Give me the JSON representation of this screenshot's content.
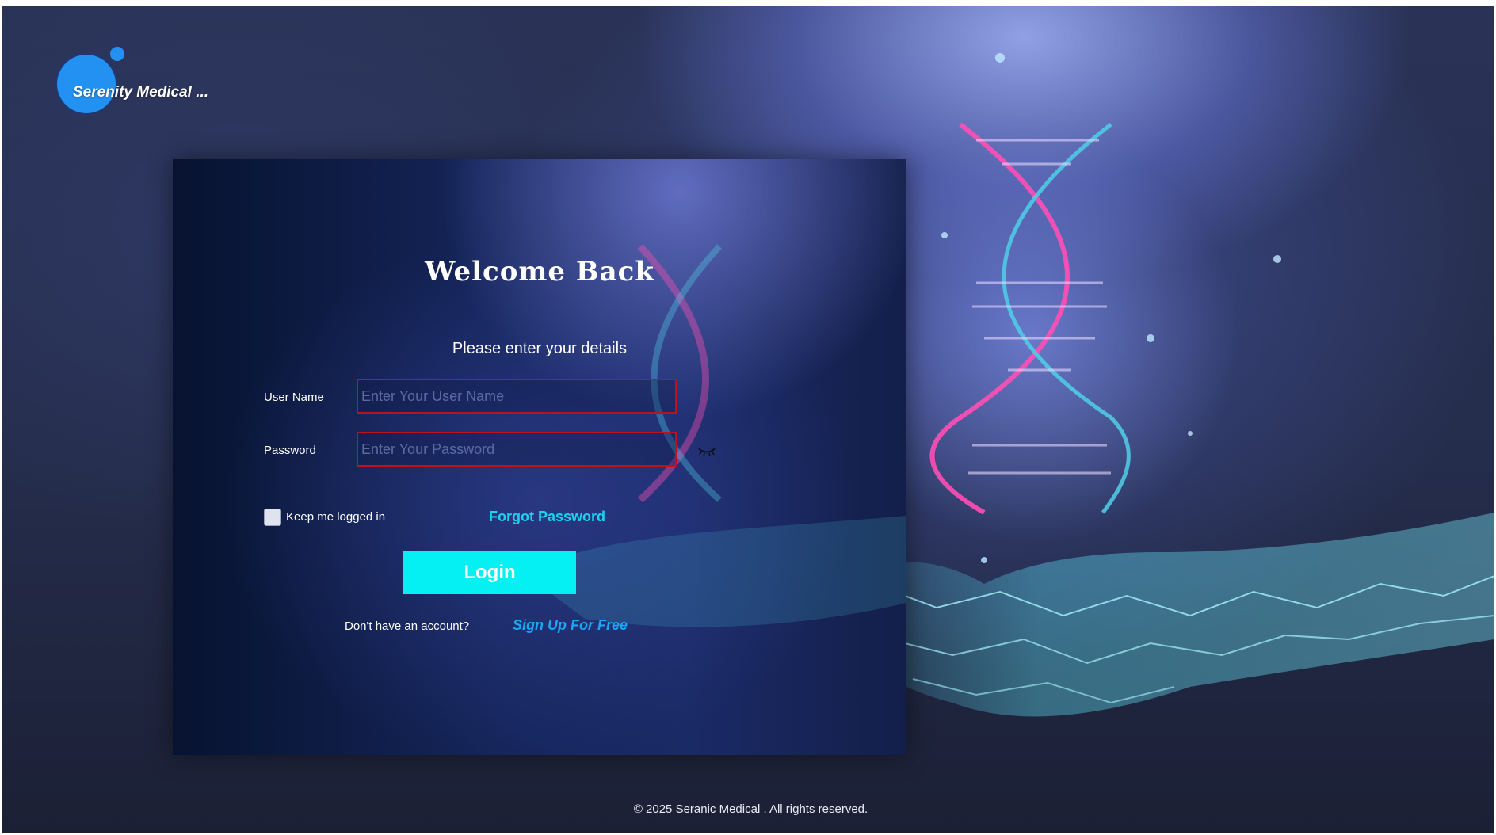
{
  "app": {
    "logo_text": "Serenity Medical ..."
  },
  "form": {
    "title": "Welcome Back",
    "subtitle": "Please enter your details",
    "username_label": "User Name",
    "username_placeholder": "Enter Your User Name",
    "password_label": "Password",
    "password_placeholder": "Enter Your Password",
    "keep_logged_in_label": "Keep me logged in",
    "keep_logged_in_checked": false,
    "forgot_password_label": "Forgot Password",
    "login_label": "Login",
    "no_account_text": "Don't have an account?",
    "signup_label": "Sign Up For Free"
  },
  "icons": {
    "password_toggle": "eye-closed-icon"
  },
  "footer": {
    "copyright": "© 2025 Seranic Medical . All rights reserved."
  },
  "colors": {
    "accent": "#05f0f2",
    "link": "#18d4ee",
    "signup_link": "#1aa7f4",
    "logo": "#2291f2",
    "input_border": "#c0101c"
  }
}
